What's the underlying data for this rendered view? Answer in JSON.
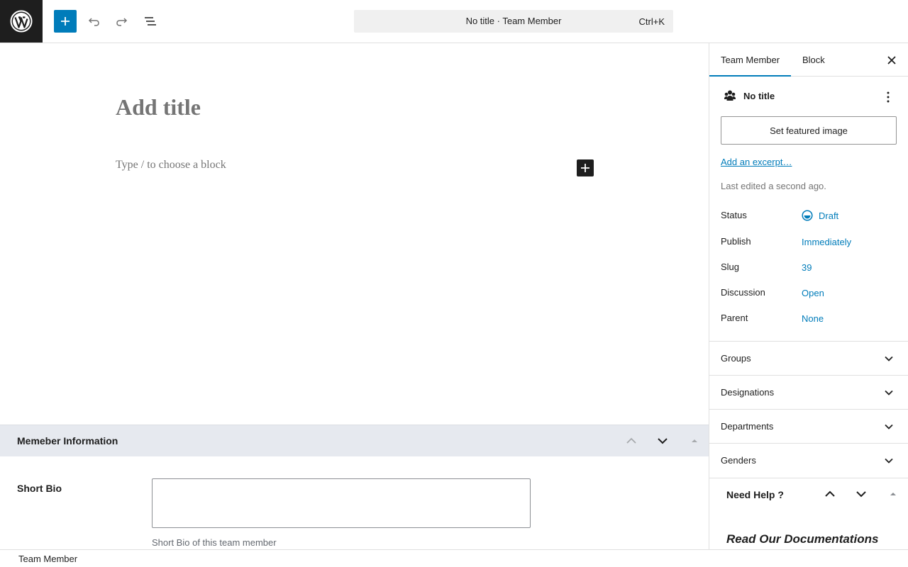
{
  "toolbar": {
    "document_title": "No title · Team Member",
    "shortcut": "Ctrl+K"
  },
  "editor": {
    "title_placeholder": "Add title",
    "block_placeholder": "Type / to choose a block"
  },
  "metabox": {
    "title": "Memeber Information",
    "field_label": "Short Bio",
    "field_help": "Short Bio of this team member",
    "field_value": ""
  },
  "sidebar": {
    "tabs": [
      {
        "label": "Team Member",
        "active": true
      },
      {
        "label": "Block",
        "active": false
      }
    ],
    "post_title": "No title",
    "featured_image_label": "Set featured image",
    "excerpt_link": "Add an excerpt…",
    "last_edited": "Last edited a second ago.",
    "rows": [
      {
        "label": "Status",
        "value": "Draft"
      },
      {
        "label": "Publish",
        "value": "Immediately"
      },
      {
        "label": "Slug",
        "value": "39"
      },
      {
        "label": "Discussion",
        "value": "Open"
      },
      {
        "label": "Parent",
        "value": "None"
      }
    ],
    "panels": [
      "Groups",
      "Designations",
      "Departments",
      "Genders"
    ],
    "help": {
      "title": "Need Help ?",
      "doc_link": "Read Our Documentations"
    }
  },
  "footer": {
    "breadcrumb": "Team Member"
  },
  "colors": {
    "accent": "#007cba",
    "dark": "#1e1e1e",
    "metabox_header": "#e6e9ef"
  }
}
